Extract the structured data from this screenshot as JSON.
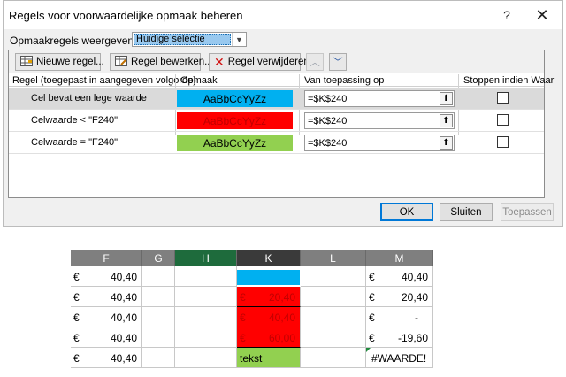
{
  "dialog": {
    "title": "Regels voor voorwaardelijke opmaak beheren",
    "help_label": "?",
    "close_label": "✕",
    "show_label": "Opmaakregels weergeven voor:",
    "show_value": "Huidige selectie",
    "toolbar": {
      "new_rule": "Nieuwe regel...",
      "edit_rule": "Regel bewerken...",
      "delete_rule": "Regel verwijderen"
    },
    "columns": {
      "rule": "Regel (toegepast in aangegeven volgorde)",
      "format": "Opmaak",
      "applies": "Van toepassing op",
      "stop": "Stoppen indien Waar"
    },
    "rules": [
      {
        "name": "Cel bevat een lege waarde",
        "preview": "AaBbCcYyZz",
        "applies": "=$K$240",
        "fill": "#00b0f0",
        "text_color": "#000000",
        "stop": false,
        "selected": true
      },
      {
        "name": "Celwaarde < \"F240\"",
        "preview": "AaBbCcYyZz",
        "applies": "=$K$240",
        "fill": "#ff0000",
        "text_color": "#c00000",
        "stop": false,
        "selected": false
      },
      {
        "name": "Celwaarde = \"F240\"",
        "preview": "AaBbCcYyZz",
        "applies": "=$K$240",
        "fill": "#92d050",
        "text_color": "#000000",
        "stop": false,
        "selected": false
      }
    ],
    "buttons": {
      "ok": "OK",
      "close": "Sluiten",
      "apply": "Toepassen"
    }
  },
  "sheet": {
    "columns": [
      "F",
      "G",
      "H",
      "K",
      "L",
      "M"
    ],
    "rows": [
      {
        "f_cur": "€",
        "f_val": "40,40",
        "k_cur": "",
        "k_val": "",
        "m_cur": "€",
        "m_val": "40,40"
      },
      {
        "f_cur": "€",
        "f_val": "40,40",
        "k_cur": "€",
        "k_val": "20,40",
        "m_cur": "€",
        "m_val": "20,40"
      },
      {
        "f_cur": "€",
        "f_val": "40,40",
        "k_cur": "€",
        "k_val": "40,40",
        "m_cur": "€",
        "m_val": "-"
      },
      {
        "f_cur": "€",
        "f_val": "40,40",
        "k_cur": "€",
        "k_val": "60,00",
        "m_cur": "€",
        "m_val": "-19,60"
      },
      {
        "f_cur": "€",
        "f_val": "40,40",
        "k_text": "tekst",
        "m_err": "#WAARDE!"
      }
    ]
  }
}
